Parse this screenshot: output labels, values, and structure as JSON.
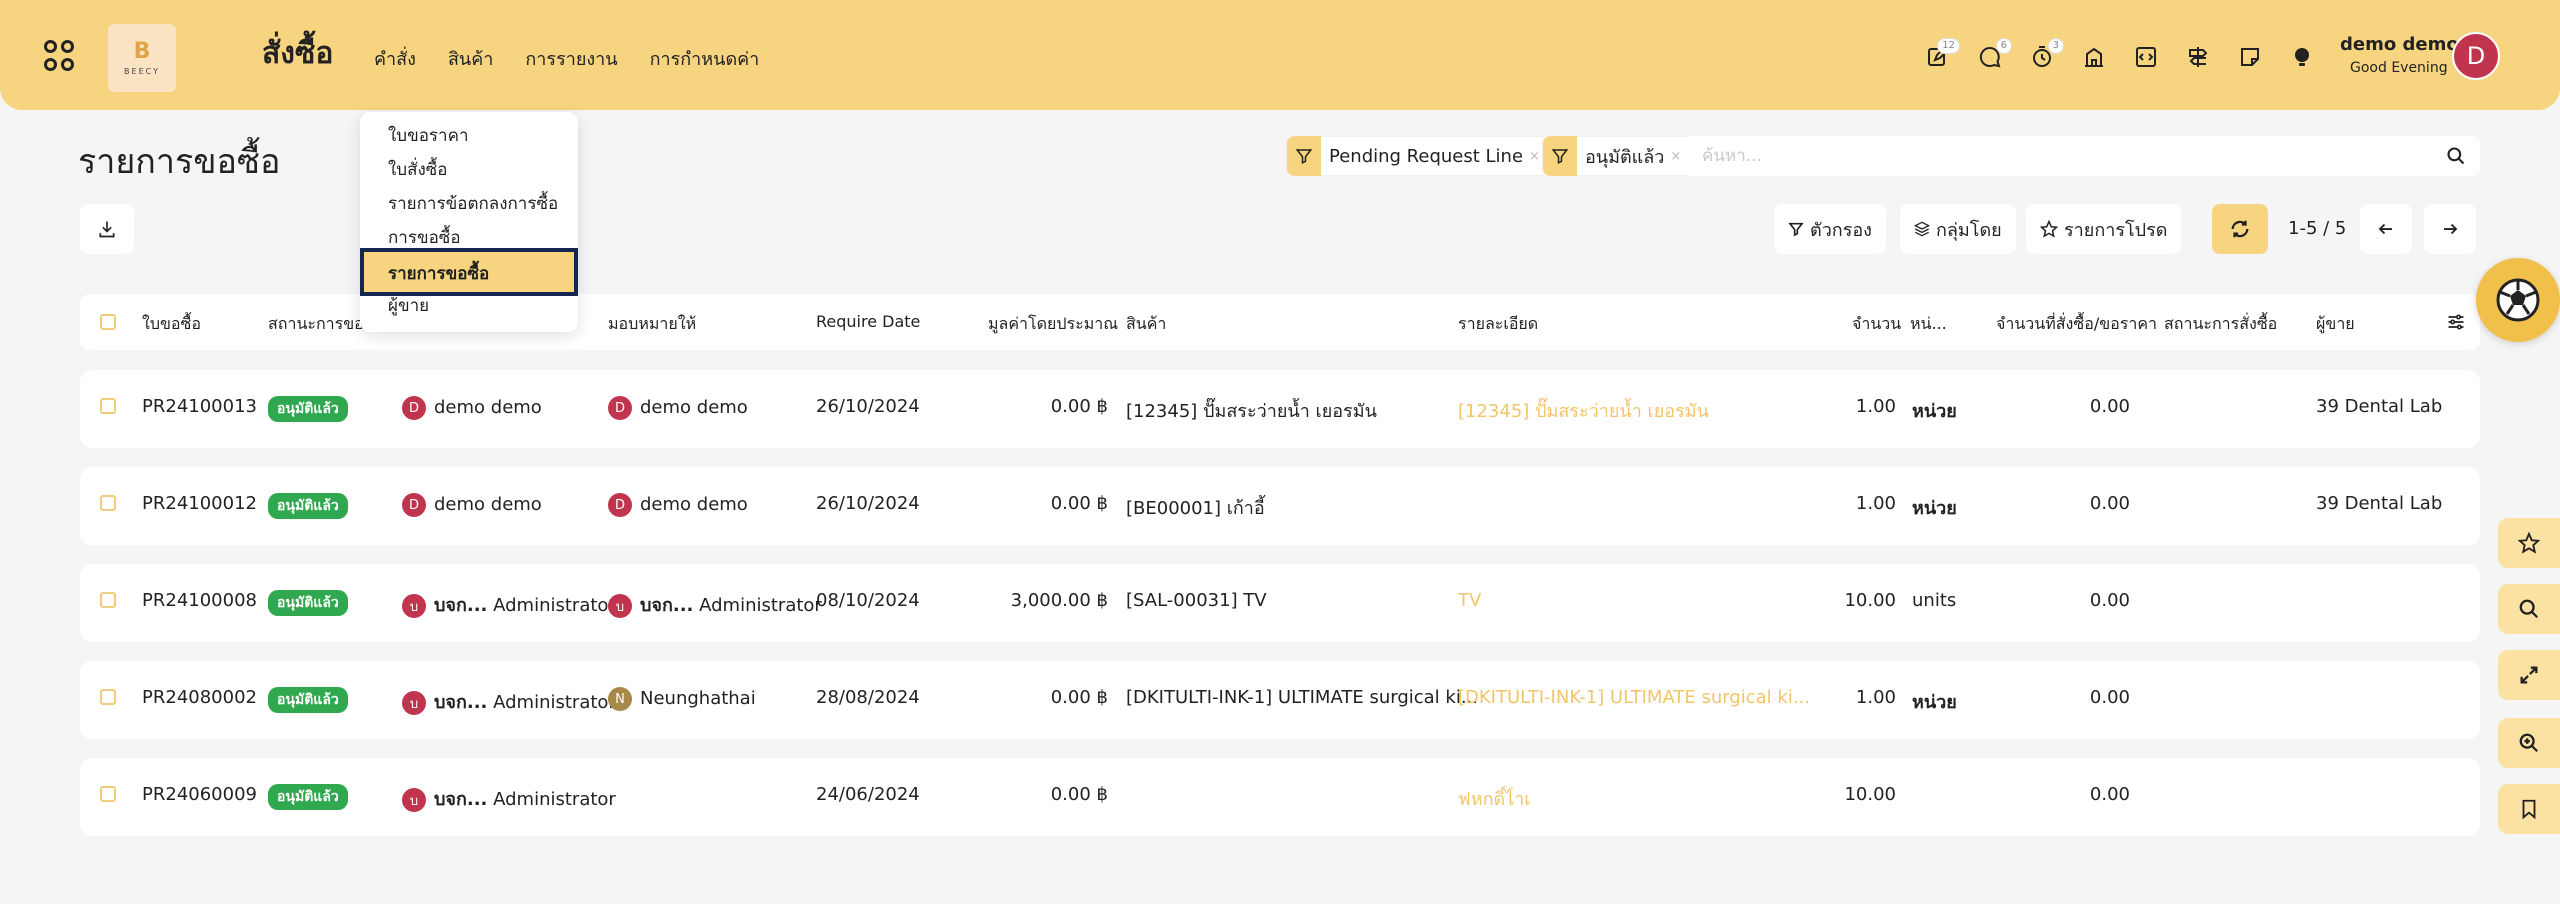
{
  "header": {
    "logo_text": "BEECY",
    "logo_letter": "B",
    "app_title": "สั่งซื้อ",
    "menu": [
      "คำสั่ง",
      "สินค้า",
      "การรายงาน",
      "การกำหนดค่า"
    ],
    "icons": [
      {
        "name": "edit-icon",
        "badge": "12"
      },
      {
        "name": "chat-icon",
        "badge": "6"
      },
      {
        "name": "timer-icon",
        "badge": "3"
      },
      {
        "name": "building-icon",
        "badge": ""
      },
      {
        "name": "code-icon",
        "badge": ""
      },
      {
        "name": "signpost-icon",
        "badge": ""
      },
      {
        "name": "note-icon",
        "badge": ""
      },
      {
        "name": "lightbulb-icon",
        "badge": ""
      }
    ],
    "user_name": "demo demo",
    "greeting": "Good Evening",
    "avatar_letter": "D"
  },
  "dropdown": {
    "items": [
      "ใบขอราคา",
      "ใบสั่งซื้อ",
      "รายการข้อตกลงการซื้อ",
      "การขอซื้อ",
      "รายการขอซื้อ",
      "ผู้ขาย"
    ],
    "active": "รายการขอซื้อ"
  },
  "page_title": "รายการขอซื้อ",
  "filters": {
    "facet1": "Pending Request Line",
    "facet2": "อนุมัติแล้ว",
    "remove": "×",
    "search_placeholder": "ค้นหา..."
  },
  "actions": {
    "filter_label": "ตัวกรอง",
    "group_label": "กลุ่มโดย",
    "favorite_label": "รายการโปรด",
    "pager": "1-5 / 5"
  },
  "table": {
    "columns": [
      "ใบขอซื้อ",
      "สถานะการขอ",
      "มอบหมายให้",
      "Require Date",
      "มูลค่าโดยประมาณ",
      "สินค้า",
      "รายละเอียด",
      "จำนวน",
      "หน่...",
      "จำนวนที่สั่งซื้อ/ขอราคา",
      "สถานะการสั่งซื้อ",
      "ผู้ขาย"
    ],
    "rows": [
      {
        "ref": "PR24100013",
        "status": "อนุมัติแล้ว",
        "requester_av": "D",
        "requester": "demo demo",
        "assignee_av": "D",
        "assignee": "demo demo",
        "date": "26/10/2024",
        "amount": "0.00 ฿",
        "product": "[12345] ปั๊มสระว่ายน้ำ เยอรมัน",
        "desc": "[12345] ปั๊มสระว่ายน้ำ เยอรมัน",
        "qty": "1.00",
        "uom": "หน่วย",
        "ordered": "0.00",
        "vendor": "39 Dental Lab"
      },
      {
        "ref": "PR24100012",
        "status": "อนุมัติแล้ว",
        "requester_av": "D",
        "requester": "demo demo",
        "assignee_av": "D",
        "assignee": "demo demo",
        "date": "26/10/2024",
        "amount": "0.00 ฿",
        "product": "[BE00001] เก้าอี้",
        "desc": "",
        "qty": "1.00",
        "uom": "หน่วย",
        "ordered": "0.00",
        "vendor": "39 Dental Lab"
      },
      {
        "ref": "PR24100008",
        "status": "อนุมัติแล้ว",
        "requester_av": "บ",
        "requester_bold": "บจก...",
        "requester": " Administrator",
        "assignee_av": "บ",
        "assignee_bold": "บจก...",
        "assignee": " Administrator",
        "date": "08/10/2024",
        "amount": "3,000.00 ฿",
        "product": "[SAL-00031] TV",
        "desc": "TV",
        "qty": "10.00",
        "uom": "units",
        "ordered": "0.00",
        "vendor": ""
      },
      {
        "ref": "PR24080002",
        "status": "อนุมัติแล้ว",
        "requester_av": "บ",
        "requester_bold": "บจก...",
        "requester": " Administrator",
        "assignee_av": "N",
        "assignee": "Neunghathai",
        "date": "28/08/2024",
        "amount": "0.00 ฿",
        "product": "[DKITULTI-INK-1] ULTIMATE surgical ki...",
        "desc": "[DKITULTI-INK-1] ULTIMATE surgical ki...",
        "qty": "1.00",
        "uom": "หน่วย",
        "ordered": "0.00",
        "vendor": ""
      },
      {
        "ref": "PR24060009",
        "status": "อนุมัติแล้ว",
        "requester_av": "บ",
        "requester_bold": "บจก...",
        "requester": " Administrator",
        "assignee_av": "",
        "assignee": "",
        "date": "24/06/2024",
        "amount": "0.00 ฿",
        "product": "",
        "desc": "ฟหกดิ์ไ่าเ",
        "qty": "10.00",
        "uom": "",
        "ordered": "0.00",
        "vendor": ""
      }
    ]
  },
  "colors": {
    "accent": "#f7d47f",
    "status_green": "#2fa84f",
    "desc_orange": "#f2c56a"
  }
}
